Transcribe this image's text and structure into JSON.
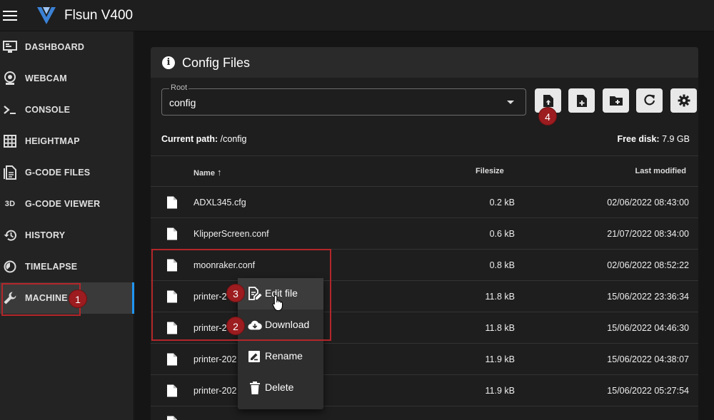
{
  "app": {
    "title": "Flsun V400"
  },
  "sidebar": {
    "items": [
      {
        "label": "DASHBOARD",
        "icon": "monitor-dashboard-icon"
      },
      {
        "label": "WEBCAM",
        "icon": "webcam-icon"
      },
      {
        "label": "CONSOLE",
        "icon": "console-icon"
      },
      {
        "label": "HEIGHTMAP",
        "icon": "grid-icon"
      },
      {
        "label": "G-CODE FILES",
        "icon": "file-document-icon"
      },
      {
        "label": "G-CODE VIEWER",
        "icon": "3d-icon",
        "icon_text": "3D"
      },
      {
        "label": "HISTORY",
        "icon": "history-icon"
      },
      {
        "label": "TIMELAPSE",
        "icon": "timelapse-icon"
      },
      {
        "label": "MACHINE",
        "icon": "wrench-icon",
        "active": true
      }
    ]
  },
  "panel": {
    "title": "Config Files",
    "root_label": "Root",
    "root_value": "config",
    "current_path_label": "Current path:",
    "current_path": "/config",
    "free_disk_label": "Free disk:",
    "free_disk": "7.9 GB"
  },
  "table": {
    "headers": {
      "name": "Name",
      "filesize": "Filesize",
      "last_modified": "Last modified"
    },
    "rows": [
      {
        "name": "ADXL345.cfg",
        "size": "0.2 kB",
        "modified": "02/06/2022 08:43:00"
      },
      {
        "name": "KlipperScreen.conf",
        "size": "0.6 kB",
        "modified": "21/07/2022 08:34:00"
      },
      {
        "name": "moonraker.conf",
        "size": "0.8 kB",
        "modified": "02/06/2022 08:52:22"
      },
      {
        "name": "printer-2",
        "size": "11.8 kB",
        "modified": "15/06/2022 23:36:34"
      },
      {
        "name": "printer-2",
        "size": "11.8 kB",
        "modified": "15/06/2022 04:46:30"
      },
      {
        "name": "printer-202",
        "size": "11.9 kB",
        "modified": "15/06/2022 04:38:07"
      },
      {
        "name": "printer-202",
        "size": "11.9 kB",
        "modified": "15/06/2022 05:27:54"
      }
    ]
  },
  "context_menu": {
    "items": [
      {
        "label": "Edit file",
        "icon": "file-edit-icon"
      },
      {
        "label": "Download",
        "icon": "cloud-download-icon"
      },
      {
        "label": "Rename",
        "icon": "rename-icon"
      },
      {
        "label": "Delete",
        "icon": "trash-icon"
      }
    ]
  },
  "annotations": {
    "badge1": "1",
    "badge2": "2",
    "badge3": "3",
    "badge4": "4"
  },
  "colors": {
    "accent": "#2196f3",
    "annotation_red": "#b3262a"
  }
}
